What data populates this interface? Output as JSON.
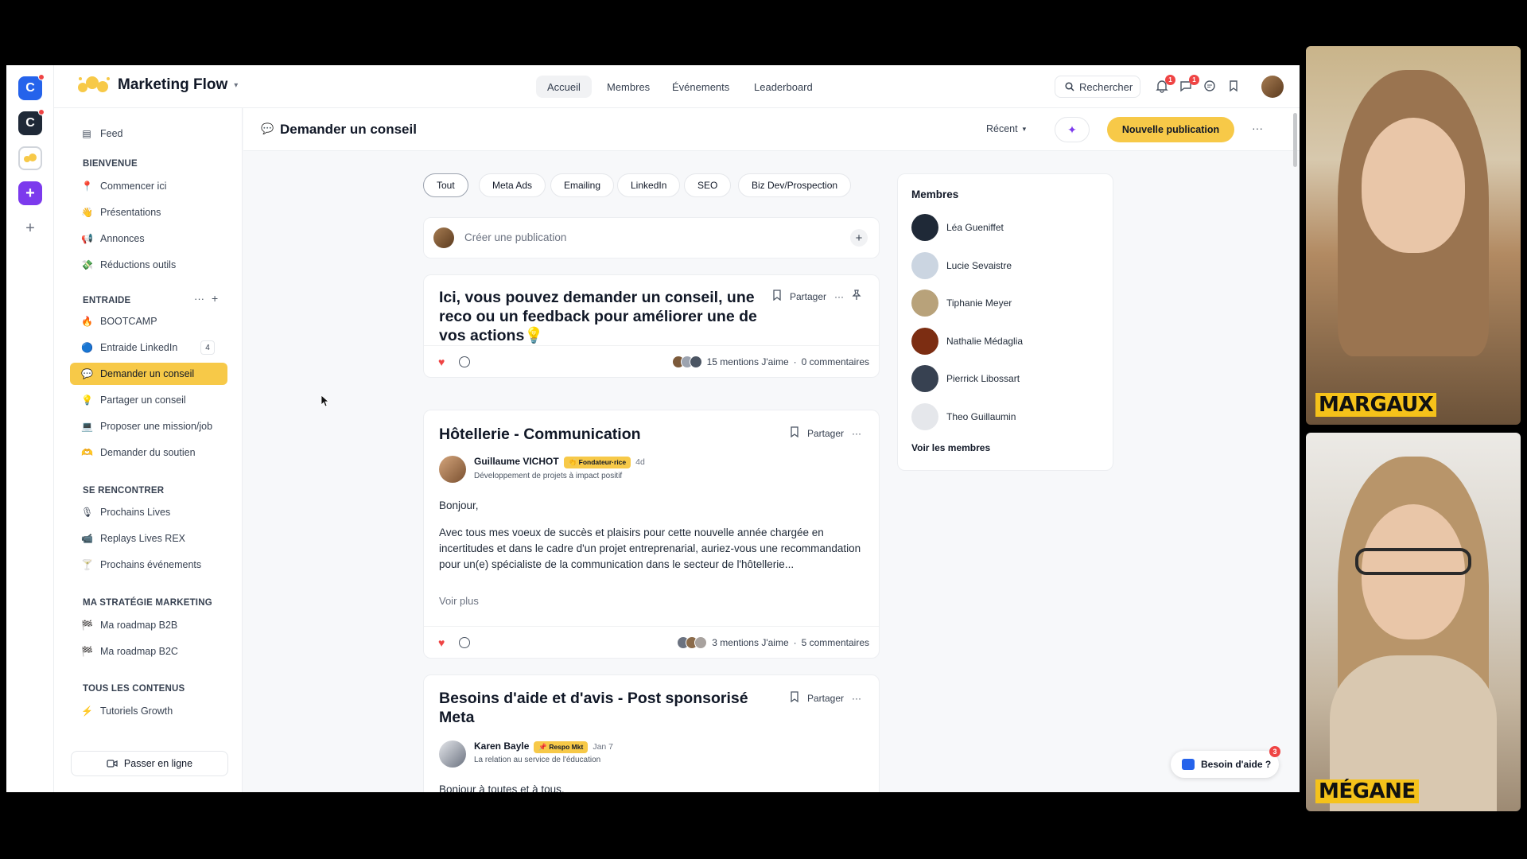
{
  "brand": {
    "name": "Marketing Flow"
  },
  "nav": {
    "tabs": [
      "Accueil",
      "Membres",
      "Événements",
      "Leaderboard"
    ],
    "active": "Accueil"
  },
  "search": {
    "label": "Rechercher"
  },
  "notifications": {
    "bell_count": "1",
    "chat_count": "1"
  },
  "sidebar": {
    "feed": "Feed",
    "sections": [
      {
        "title": "BIENVENUE",
        "items": [
          {
            "label": "Commencer ici",
            "icon": "📍"
          },
          {
            "label": "Présentations",
            "icon": "👋"
          },
          {
            "label": "Annonces",
            "icon": "📢"
          },
          {
            "label": "Réductions outils",
            "icon": "💸"
          }
        ]
      },
      {
        "title": "ENTRAIDE",
        "items": [
          {
            "label": "BOOTCAMP",
            "icon": "🔥"
          },
          {
            "label": "Entraide LinkedIn",
            "icon": "🔵",
            "count": "4"
          },
          {
            "label": "Demander un conseil",
            "icon": "💬",
            "active": true
          },
          {
            "label": "Partager un conseil",
            "icon": "💡"
          },
          {
            "label": "Proposer une mission/job",
            "icon": "💻"
          },
          {
            "label": "Demander du soutien",
            "icon": "🫶"
          }
        ]
      },
      {
        "title": "SE RENCONTRER",
        "items": [
          {
            "label": "Prochains Lives",
            "icon": "🎙"
          },
          {
            "label": "Replays Lives REX",
            "icon": "📹"
          },
          {
            "label": "Prochains événements",
            "icon": "🍸"
          }
        ]
      },
      {
        "title": "MA STRATÉGIE MARKETING",
        "items": [
          {
            "label": "Ma roadmap B2B",
            "icon": "🏁"
          },
          {
            "label": "Ma roadmap B2C",
            "icon": "🏁"
          }
        ]
      },
      {
        "title": "TOUS LES CONTENUS",
        "items": [
          {
            "label": "Tutoriels Growth",
            "icon": "⚡"
          }
        ]
      }
    ],
    "go_live": "Passer en ligne"
  },
  "page": {
    "title": "Demander un conseil",
    "sort": "Récent",
    "new_post": "Nouvelle publication"
  },
  "filters": [
    "Tout",
    "Meta Ads",
    "Emailing",
    "LinkedIn",
    "SEO",
    "Biz Dev/Prospection"
  ],
  "composer": {
    "placeholder": "Créer une publication"
  },
  "posts": [
    {
      "title": "Ici, vous pouvez demander un conseil, une reco ou un feedback pour améliorer une de vos actions💡",
      "share": "Partager",
      "likes": "15 mentions J'aime",
      "comments": "0 commentaires"
    },
    {
      "title": "Hôtellerie - Communication",
      "share": "Partager",
      "author": "Guillaume VICHOT",
      "role": "👏 Fondateur·rice",
      "time": "4d",
      "headline": "Développement de projets à impact positif",
      "greeting": "Bonjour,",
      "body": "Avec tous mes voeux de succès et plaisirs pour cette nouvelle année chargée en incertitudes et dans le cadre d'un projet entreprenarial, auriez-vous une recommandation pour un(e) spécialiste de la communication dans le secteur de l'hôtellerie...",
      "more": "Voir plus",
      "likes": "3 mentions J'aime",
      "comments": "5 commentaires"
    },
    {
      "title": "Besoins d'aide et d'avis - Post sponsorisé Meta",
      "share": "Partager",
      "author": "Karen Bayle",
      "role": "📌 Respo Mkt",
      "time": "Jan 7",
      "headline": "La relation au service de l'éducation",
      "greeting": "Bonjour à toutes et à tous,"
    }
  ],
  "members": {
    "title": "Membres",
    "list": [
      "Léa Gueniffet",
      "Lucie Sevaistre",
      "Tiphanie Meyer",
      "Nathalie Médaglia",
      "Pierrick Libossart",
      "Theo Guillaumin"
    ],
    "see_all": "Voir les membres"
  },
  "help": {
    "label": "Besoin d'aide ?",
    "count": "3"
  },
  "video": {
    "top_name": "MARGAUX",
    "bottom_name": "MÉGANE"
  },
  "colors": {
    "accent": "#f7c948",
    "badge": "#ef4444",
    "rail_blue": "#2563eb",
    "rail_purple": "#7c3aed"
  }
}
